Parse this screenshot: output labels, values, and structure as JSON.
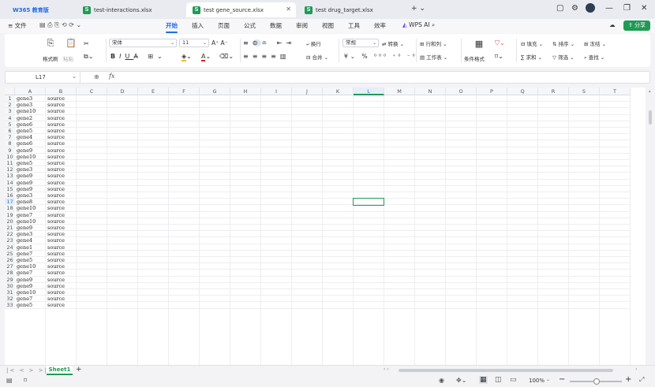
{
  "titlebar": {
    "wps_brand": "W365 教育版",
    "tabs": [
      {
        "label": "test-interactions.xlsx"
      },
      {
        "label": "test gene_source.xlsx"
      },
      {
        "label": "test drug_target.xlsx"
      }
    ],
    "add_tab": "+ ⌄"
  },
  "menubar": {
    "file": "≡ 文件",
    "items": [
      "开始",
      "插入",
      "页面",
      "公式",
      "数据",
      "审阅",
      "视图",
      "工具",
      "效率"
    ],
    "wps_ai": "WPS AI",
    "share": "分享"
  },
  "ribbon": {
    "format_painter": "格式刷",
    "paste": "粘贴",
    "font_name": "宋体",
    "font_size": "11",
    "wrap": "换行",
    "merge": "合并",
    "number_format": "常规",
    "convert": "转换",
    "row_col": "行和列",
    "worksheet": "工作表",
    "cond_format": "条件格式",
    "fill": "填充",
    "sort": "排序",
    "freeze": "冻结",
    "sum": "求和",
    "filter": "筛选",
    "find": "查找"
  },
  "formulabar": {
    "name_box": "L17",
    "fx": "fx",
    "content": ""
  },
  "sheet": {
    "columns": [
      "A",
      "B",
      "C",
      "D",
      "E",
      "F",
      "G",
      "H",
      "I",
      "J",
      "K",
      "L",
      "M",
      "N",
      "O",
      "P",
      "Q",
      "R",
      "S",
      "T"
    ],
    "selected_column": "L",
    "selected_row": 17,
    "rows": [
      [
        "gene3",
        "source"
      ],
      [
        "gene3",
        "source"
      ],
      [
        "gene10",
        "source"
      ],
      [
        "gene2",
        "source"
      ],
      [
        "gene6",
        "source"
      ],
      [
        "gene5",
        "source"
      ],
      [
        "gene4",
        "source"
      ],
      [
        "gene6",
        "source"
      ],
      [
        "gene9",
        "source"
      ],
      [
        "gene10",
        "source"
      ],
      [
        "gene5",
        "source"
      ],
      [
        "gene3",
        "source"
      ],
      [
        "gene9",
        "source"
      ],
      [
        "gene9",
        "source"
      ],
      [
        "gene9",
        "source"
      ],
      [
        "gene3",
        "source"
      ],
      [
        "gene8",
        "source"
      ],
      [
        "gene10",
        "source"
      ],
      [
        "gene7",
        "source"
      ],
      [
        "gene10",
        "source"
      ],
      [
        "gene9",
        "source"
      ],
      [
        "gene3",
        "source"
      ],
      [
        "gene4",
        "source"
      ],
      [
        "gene1",
        "source"
      ],
      [
        "gene7",
        "source"
      ],
      [
        "gene5",
        "source"
      ],
      [
        "gene10",
        "source"
      ],
      [
        "gene7",
        "source"
      ],
      [
        "gene9",
        "source"
      ],
      [
        "gene9",
        "source"
      ],
      [
        "gene10",
        "source"
      ],
      [
        "gene7",
        "source"
      ],
      [
        "gene5",
        "source"
      ]
    ]
  },
  "sheetbar": {
    "nav": "|< < > >|",
    "sheet_tab": "Sheet1",
    "add_sheet": "+"
  },
  "statusbar": {
    "zoom": "100%"
  },
  "colors": {
    "accent": "#1e6ce8",
    "excel_green": "#1f9b55",
    "selection_border": "#1f9b55"
  }
}
